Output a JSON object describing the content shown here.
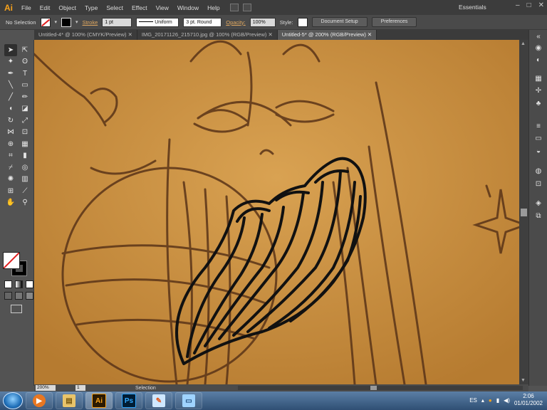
{
  "app": {
    "logo_text": "Ai"
  },
  "menu": [
    "File",
    "Edit",
    "Object",
    "Type",
    "Select",
    "Effect",
    "View",
    "Window",
    "Help"
  ],
  "workspace": "Essentials",
  "control_bar": {
    "selection": "No Selection",
    "stroke_label": "Stroke",
    "stroke_weight": "1 pt",
    "profile": "Uniform",
    "brush": "3 pt. Round",
    "opacity_label": "Opacity:",
    "opacity_value": "100%",
    "style_label": "Style:",
    "document_setup": "Document Setup",
    "preferences": "Preferences"
  },
  "tabs": [
    "Untitled-4* @ 100% (CMYK/Preview)",
    "IMG_20171126_215710.jpg @ 100% (RGB/Preview)",
    "Untitled-5* @ 200% (RGB/Preview)"
  ],
  "active_tab": 2,
  "status": {
    "zoom": "200%",
    "page": "1",
    "tool": "Selection"
  },
  "tray": {
    "lang": "ES",
    "time": "2:06",
    "date": "01/01/2002"
  },
  "taskbar": {
    "apps": [
      {
        "name": "media-player-icon",
        "glyph": "▶",
        "color": "#e87722"
      },
      {
        "name": "explorer-icon",
        "glyph": "▤",
        "color": "#e9c46a"
      },
      {
        "name": "illustrator-icon",
        "glyph": "Ai",
        "color": "#f7a21b"
      },
      {
        "name": "photoshop-icon",
        "glyph": "Ps",
        "color": "#31a8ff"
      },
      {
        "name": "paint-icon",
        "glyph": "✎",
        "color": "#7fc8ff"
      },
      {
        "name": "window-icon",
        "glyph": "▭",
        "color": "#9fd3ff"
      }
    ]
  },
  "colors": {
    "canvas": "#c8913f",
    "accent": "#f7a21b"
  }
}
